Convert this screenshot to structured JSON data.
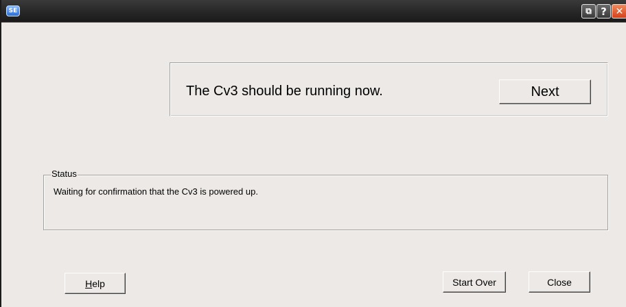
{
  "titlebar": {
    "app_icon_label": "SE",
    "restore_glyph": "⧉",
    "help_glyph": "?",
    "close_glyph": "✕"
  },
  "main": {
    "message": "The Cv3 should be running now.",
    "next_label": "Next"
  },
  "status": {
    "legend": "Status",
    "text": "Waiting for confirmation that the Cv3 is powered up."
  },
  "footer": {
    "help_mnemonic": "H",
    "help_rest": "elp",
    "start_over_label": "Start Over",
    "close_label": "Close"
  }
}
